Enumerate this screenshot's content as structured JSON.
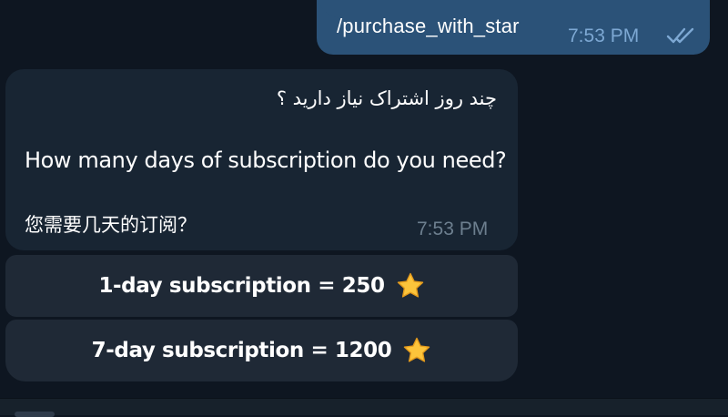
{
  "outgoing": {
    "text": "/purchase_with_star",
    "time": "7:53 PM",
    "status_icon": "double-check-icon"
  },
  "incoming": {
    "persian": "چند روز اشتراک نیاز دارید ؟",
    "english": "How many days of subscription do you need?",
    "chinese": "您需要几天的订阅？",
    "time": "7:53 PM"
  },
  "keyboard": {
    "buttons": [
      {
        "label": "1-day subscription = 250",
        "icon": "star-icon"
      },
      {
        "label": "7-day subscription = 1200",
        "icon": "star-icon"
      }
    ]
  },
  "colors": {
    "background": "#0e1621",
    "outgoing_bubble": "#2b5278",
    "incoming_bubble": "#182533",
    "keyboard_button": "#1f2936",
    "star": "#fcc43b"
  }
}
